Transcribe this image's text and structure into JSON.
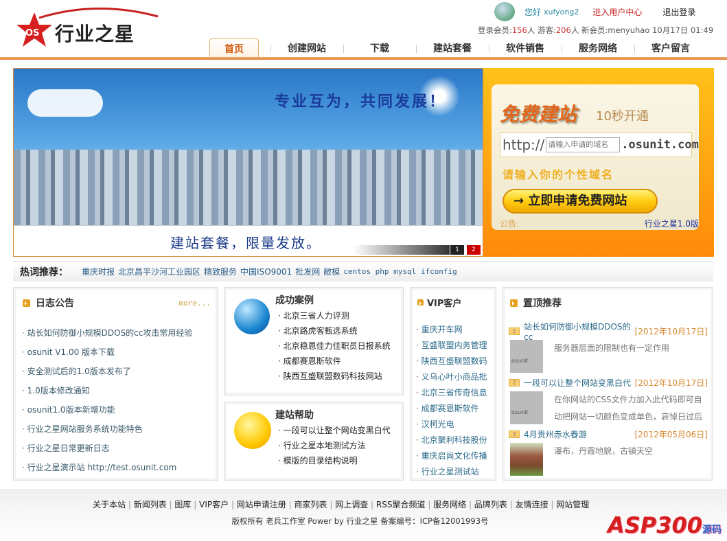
{
  "header": {
    "logo_text": "行业之星",
    "logo_badge": "OS",
    "greeting": "您好",
    "username": "xufyong2",
    "user_center": "进入用户中心",
    "logout": "退出登录",
    "stats": {
      "members_label": "登录会员:",
      "members": "156",
      "unit": "人",
      "guests_label": "游客:",
      "guests": "206",
      "new_label": "新会员:",
      "new_member": "menyuhao",
      "datetime": "10月17日 01:49"
    }
  },
  "nav": [
    "首页",
    "创建网站",
    "下载",
    "建站套餐",
    "软件销售",
    "服务网络",
    "客户留言"
  ],
  "banner": {
    "slogan": "专业互为，共同发展！",
    "caption": "建站套餐，限量发放。",
    "pages": [
      "1",
      "2"
    ]
  },
  "promo": {
    "title": "免费建站",
    "subtitle": "10秒开通",
    "http": "http://",
    "placeholder": "请输入申请的域名",
    "domain": ".osunit.com",
    "hint": "请输入你的个性域名",
    "button": "→ 立即申请免费网站",
    "notice": "公告:",
    "version": "行业之星1.0版"
  },
  "hot": {
    "label": "热词推荐：",
    "words": [
      "重庆时报",
      "北京昌平沙河工业园区",
      "精致服务",
      "中国ISO9001",
      "批发网",
      "敝模",
      "centos php mysql ifconfig"
    ]
  },
  "news": {
    "title": "日志公告",
    "more": "more...",
    "items": [
      "站长如何防御小规模DDOS的cc攻击常用经验",
      "osunit V1.00 版本下载",
      "安全测试后的1.0版本发布了",
      "1.0版本修改通知",
      "osunit1.0版本新增功能",
      "行业之星网站服务系统功能特色",
      "行业之星日常更新日志",
      "行业之星演示站 http://test.osunit.com"
    ]
  },
  "cases": {
    "title": "成功案例",
    "items": [
      "北京三省人力评测",
      "北京路虎客甄选系统",
      "北京稳恩佳力佳职员日报系统",
      "成都赛恩斯软件",
      "陕西互盛联盟数码科技网站"
    ]
  },
  "help": {
    "title": "建站帮助",
    "items": [
      "一段可以让整个网站变黑白代",
      "行业之星本地测试方法",
      "模版的目录结构说明"
    ]
  },
  "vip": {
    "title": "VIP客户",
    "items": [
      "重庆开车网",
      "互盛联盟内务管理",
      "陕西互盛联盟数码",
      "义乌心叶小商品批",
      "北京三省传奇信息",
      "成都赛恩斯软件",
      "汉柯光电",
      "北京聚利科技股份",
      "重庆启尚文化传播",
      "行业之星测试站"
    ]
  },
  "top": {
    "title": "置顶推荐",
    "items": [
      {
        "num": "1",
        "title": "站长如何防御小规模DDOS的cc",
        "date": "[2012年10月17日]",
        "thumb": "osunit",
        "desc": "服务器层面的限制也有一定作用"
      },
      {
        "num": "2",
        "title": "一段可以让整个网站变黑白代",
        "date": "[2012年10月17日]",
        "thumb": "osunit",
        "desc": "在你网站的CSS文件力加入此代码即可自动把网站一切颜色变成单色，哀悼日过后"
      },
      {
        "num": "3",
        "title": "4月贵州赤水春游",
        "date": "[2012年05月06日]",
        "thumb": "",
        "desc": "瀑布，丹霞地貌，古镇天空"
      }
    ]
  },
  "footer": {
    "links": [
      "关于本站",
      "新闻列表",
      "图库",
      "VIP客户",
      "网站申请注册",
      "商家列表",
      "网上调查",
      "RSS聚合频道",
      "服务网络",
      "品牌列表",
      "友情连接",
      "网站管理"
    ],
    "copyright": "版权所有 老兵工作室 Power by 行业之星 备案编号：ICP备12001993号",
    "watermark": "ASP300",
    "watermark_sub": "源码"
  }
}
